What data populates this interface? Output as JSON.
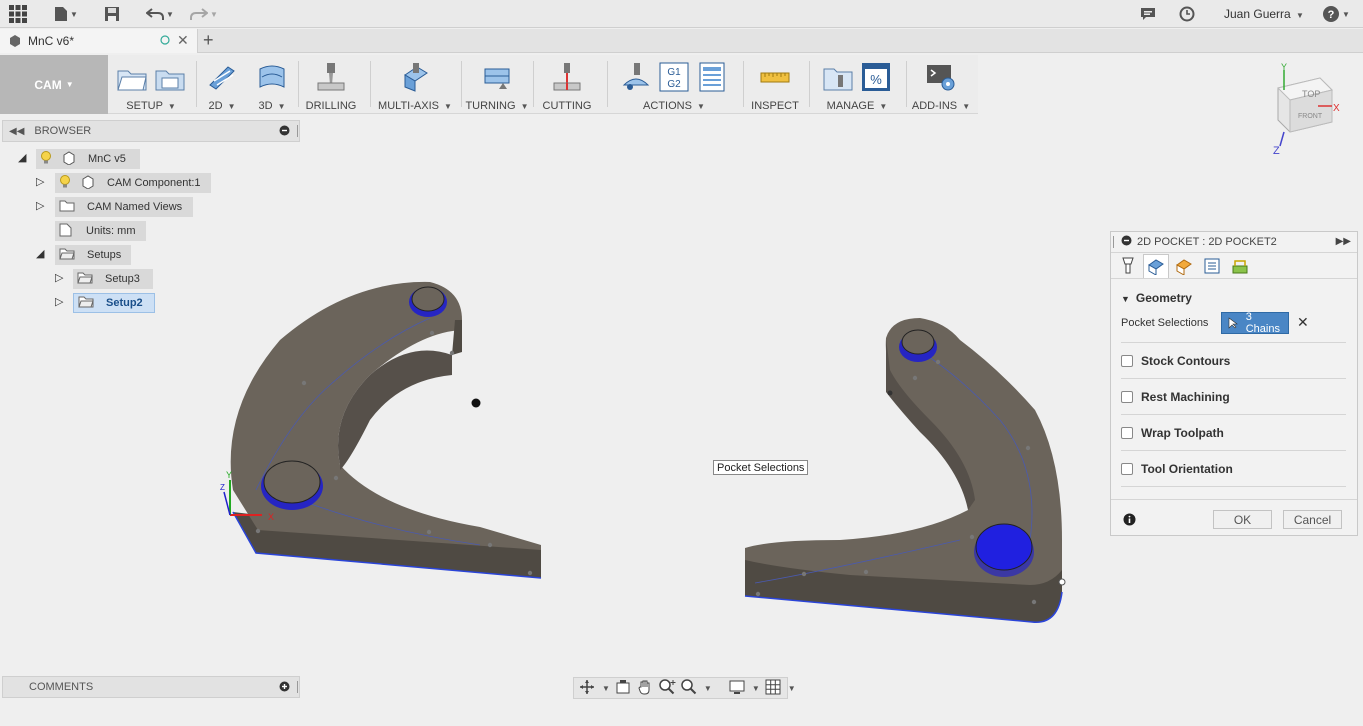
{
  "app": {
    "user_name": "Juan Guerra",
    "colors": {
      "accent": "#2a6ebb",
      "selection": "#4a86c5",
      "part_body": "#6b645b",
      "hole_highlight": "#1a1ad6"
    }
  },
  "tabs": [
    {
      "label": "MnC v6*",
      "icon": "document-icon"
    }
  ],
  "ribbon": {
    "workspace_label": "CAM",
    "groups": [
      {
        "label": "SETUP",
        "icons": [
          "setup-folder-icon",
          "setup-sheet-icon"
        ]
      },
      {
        "label": "2D",
        "icons": [
          "2d-icon"
        ]
      },
      {
        "label": "3D",
        "icons": [
          "3d-icon"
        ]
      },
      {
        "label": "DRILLING",
        "icons": [
          "drill-icon"
        ]
      },
      {
        "label": "MULTI-AXIS",
        "icons": [
          "multi-axis-icon"
        ]
      },
      {
        "label": "TURNING",
        "icons": [
          "turning-icon"
        ]
      },
      {
        "label": "CUTTING",
        "icons": [
          "cutting-icon"
        ]
      },
      {
        "label": "ACTIONS",
        "icons": [
          "simulate-icon",
          "post-icon",
          "setup-sheet-icon"
        ]
      },
      {
        "label": "INSPECT",
        "icons": [
          "measure-icon"
        ]
      },
      {
        "label": "MANAGE",
        "icons": [
          "tool-library-icon",
          "template-icon"
        ]
      },
      {
        "label": "ADD-INS",
        "icons": [
          "scripts-icon"
        ]
      }
    ],
    "post_icon_text": [
      "G1",
      "G2"
    ],
    "percent_icon_text": "%"
  },
  "viewcube": {
    "top": "TOP",
    "front": "FRONT",
    "axes": {
      "x": "X",
      "y": "Y",
      "z": "Z"
    }
  },
  "browser": {
    "title": "BROWSER",
    "tree": [
      {
        "label": "MnC v5"
      },
      {
        "label": "CAM Component:1"
      },
      {
        "label": "CAM Named Views"
      },
      {
        "label": "Units: mm"
      },
      {
        "label": "Setups"
      },
      {
        "label": "Setup3"
      },
      {
        "label": "Setup2"
      }
    ]
  },
  "comments": {
    "title": "COMMENTS"
  },
  "viewport": {
    "tooltip": "Pocket Selections",
    "origin_axes": {
      "x": "X",
      "y": "Y",
      "z": "Z"
    }
  },
  "panel": {
    "title": "2D POCKET : 2D POCKET2",
    "section": "Geometry",
    "pocket_label": "Pocket Selections",
    "pocket_value": "3 Chains",
    "options": [
      {
        "label": "Stock Contours",
        "checked": false
      },
      {
        "label": "Rest Machining",
        "checked": false
      },
      {
        "label": "Wrap Toolpath",
        "checked": false
      },
      {
        "label": "Tool Orientation",
        "checked": false
      }
    ],
    "ok": "OK",
    "cancel": "Cancel"
  }
}
